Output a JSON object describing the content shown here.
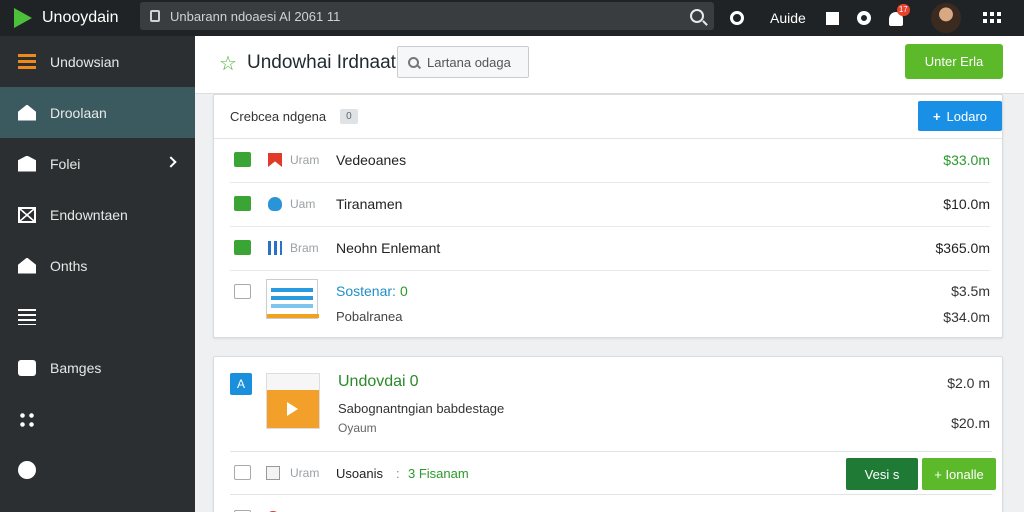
{
  "app": {
    "brand": "Unooydain",
    "search_value": "Unbarann ndoaesi Al 2061 11"
  },
  "topbar": {
    "user_label": "Auide",
    "notification_count": "17"
  },
  "sidebar": {
    "items": [
      {
        "label": "Undowsian",
        "icon": "orange-grid-icon"
      },
      {
        "label": "Droolaan",
        "icon": "home-icon",
        "active": true
      },
      {
        "label": "Folei",
        "icon": "box-icon",
        "has_chevron": true
      },
      {
        "label": "Endowntaen",
        "icon": "mail-icon"
      },
      {
        "label": "Onths",
        "icon": "house-icon"
      },
      {
        "label": "",
        "icon": "list-icon"
      },
      {
        "label": "Bamges",
        "icon": "camera-icon"
      },
      {
        "label": "",
        "icon": "dots-icon"
      },
      {
        "label": "",
        "icon": "power-icon"
      }
    ]
  },
  "header": {
    "title": "Undowhai Irdnaat",
    "search_placeholder": "Lartana odaga",
    "primary_button": "Unter Erla"
  },
  "card1": {
    "head_label": "Crebcea  ndgena",
    "count": "0",
    "button_label": "Lodaro",
    "rows": [
      {
        "tag": "Uram",
        "name": "Vedeoanes",
        "amount": "$33.0m",
        "type": "red-flag-icon",
        "green": true
      },
      {
        "tag": "Uam",
        "name": "Tiranamen",
        "amount": "$10.0m",
        "type": "cloud-icon",
        "green": false
      },
      {
        "tag": "Bram",
        "name": "Neohn Enlemant",
        "amount": "$365.0m",
        "type": "bars-icon",
        "green": false
      }
    ],
    "sub_item": {
      "name": "Sostenar:",
      "count": "0",
      "desc": "Pobalranea",
      "amount1": "$3.5m",
      "amount2": "$34.0m"
    }
  },
  "card2": {
    "badge": "A",
    "title": "Undovdai",
    "title_count": "0",
    "desc": "Sabognantngian babdestage",
    "sub": "Oyaum",
    "amount1": "$2.0 m",
    "amount2": "$20.m",
    "row": {
      "tag": "Uram",
      "label": "Usoanis",
      "sep": ":",
      "link": "3 Fisanam",
      "btn_dark": "Vesi s",
      "btn_light": "+ Ionalle"
    }
  },
  "colors": {
    "accent_green": "#5cb92a",
    "accent_blue": "#1990e6",
    "sidebar_bg": "#2b2f31",
    "active_bg": "#3b5a5f"
  }
}
